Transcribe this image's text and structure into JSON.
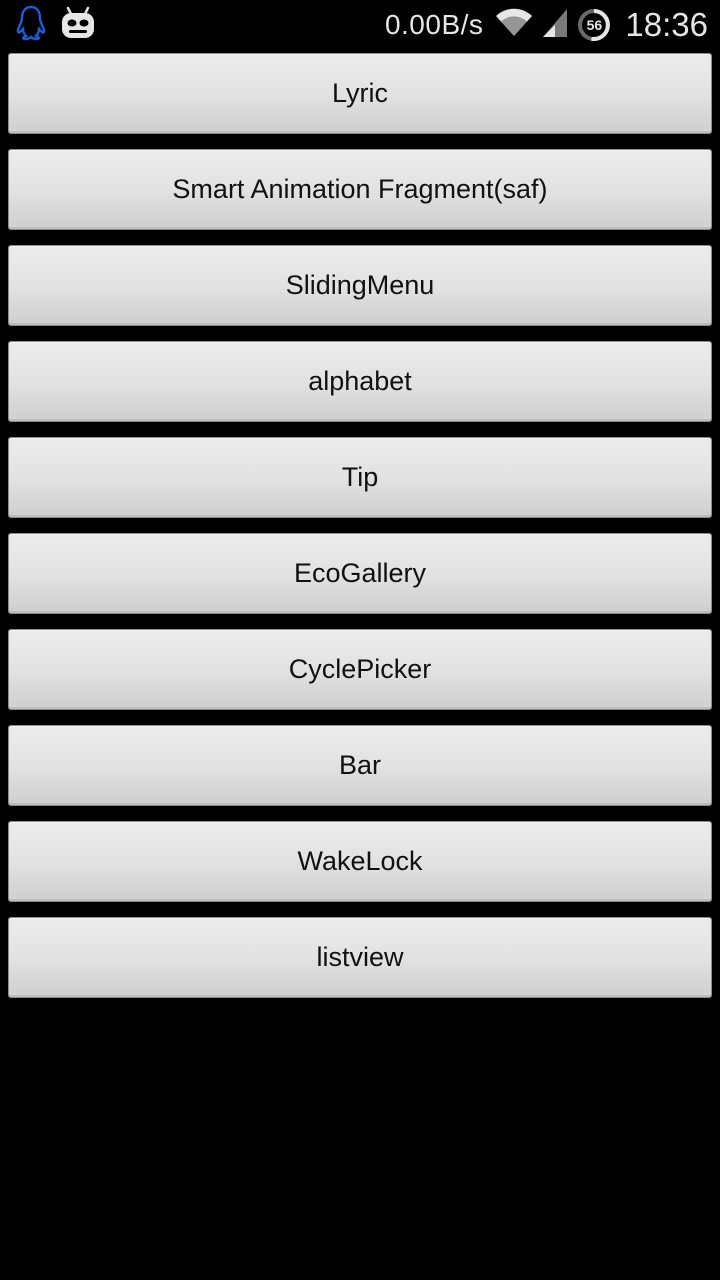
{
  "status_bar": {
    "icons_left": [
      "qq-penguin-icon",
      "cyanogenmod-android-icon"
    ],
    "net_speed": "0.00B/s",
    "icons_right": [
      "wifi-icon",
      "signal-icon"
    ],
    "battery_level": "56",
    "time": "18:36",
    "colors": {
      "text": "#e6e6e6",
      "penguin": "#1e5bd6"
    }
  },
  "buttons": [
    "Lyric",
    "Smart Animation Fragment(saf)",
    "SlidingMenu",
    "alphabet",
    "Tip",
    "EcoGallery",
    "CyclePicker",
    "Bar",
    "WakeLock",
    "listview"
  ]
}
